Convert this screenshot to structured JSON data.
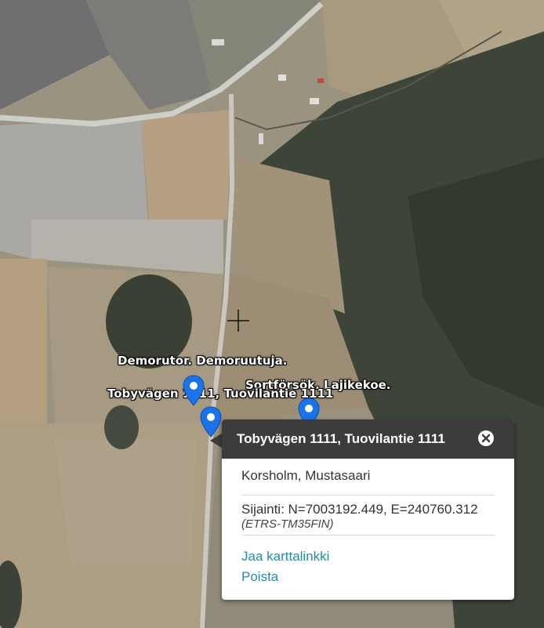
{
  "map": {
    "labels": [
      {
        "text": "Demorutor. Demoruutuja."
      },
      {
        "text": "Sortförsök. Lajikekoe."
      },
      {
        "text": "Tobyvägen 1111, Tuovilantie 1111"
      }
    ],
    "marker_color": "#1a73e8"
  },
  "popup": {
    "title": "Tobyvägen 1111, Tuovilantie 1111",
    "municipality": "Korsholm, Mustasaari",
    "coordinates": "Sijainti: N=7003192.449, E=240760.312",
    "crs": "(ETRS-TM35FIN)",
    "share_link": "Jaa karttalinkki",
    "remove_link": "Poista",
    "header_color": "#3c3c3c",
    "link_color": "#2a8aa6"
  }
}
